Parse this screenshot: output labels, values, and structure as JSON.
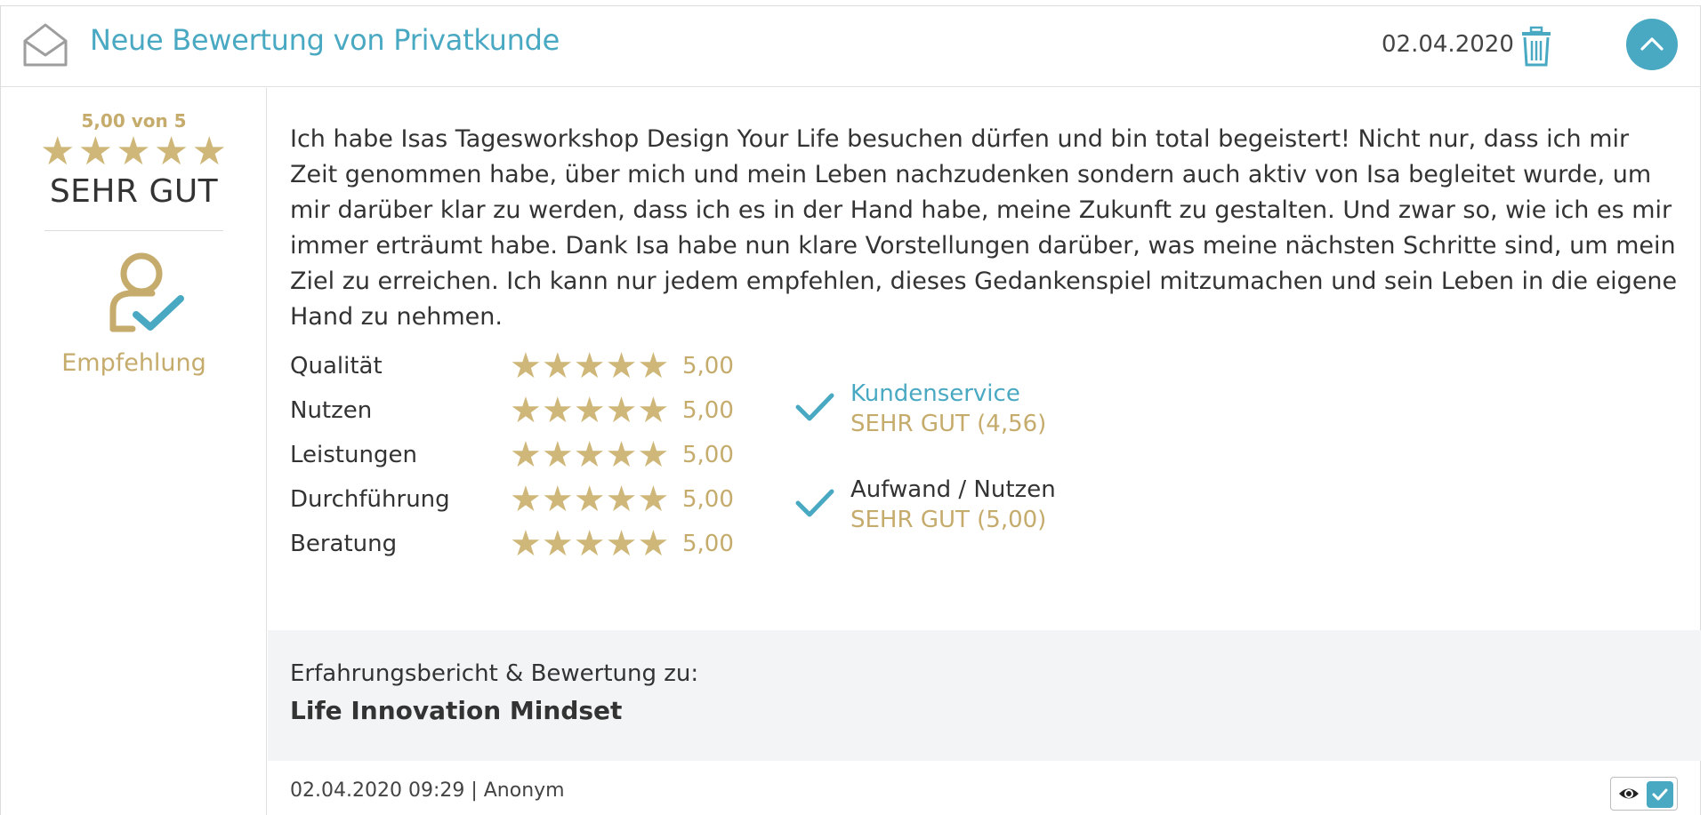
{
  "header": {
    "title": "Neue Bewertung von Privatkunde",
    "date": "02.04.2020",
    "icons": {
      "envelope": "envelope-icon",
      "trash": "trash-icon",
      "collapse": "chevron-up-icon"
    }
  },
  "summary": {
    "score_text": "5,00 von 5",
    "stars": 5,
    "grade": "SEHR GUT",
    "recommendation": "Empfehlung"
  },
  "review_text": "Ich habe Isas Tagesworkshop Design Your Life besuchen dürfen und bin total begeistert! Nicht nur, dass ich mir Zeit genommen habe, über mich und mein Leben nachzudenken sondern auch aktiv von Isa begleitet wurde, um mir darüber klar zu werden, dass ich es in der Hand habe, meine Zukunft zu gestalten. Und zwar so, wie ich es mir immer erträumt habe. Dank Isa habe nun klare Vorstellungen darüber, was meine nächsten Schritte sind, um mein Ziel zu erreichen. Ich kann nur jedem empfehlen, dieses Gedankenspiel mitzumachen und sein Leben in die eigene Hand zu nehmen.",
  "ratings": [
    {
      "label": "Qualität",
      "stars": 5,
      "value": "5,00"
    },
    {
      "label": "Nutzen",
      "stars": 5,
      "value": "5,00"
    },
    {
      "label": "Leistungen",
      "stars": 5,
      "value": "5,00"
    },
    {
      "label": "Durchführung",
      "stars": 5,
      "value": "5,00"
    },
    {
      "label": "Beratung",
      "stars": 5,
      "value": "5,00"
    }
  ],
  "checks": [
    {
      "title": "Kundenservice",
      "subtitle": "SEHR GUT (4,56)",
      "title_color": "#4aa9c2"
    },
    {
      "title": "Aufwand / Nutzen",
      "subtitle": "SEHR GUT (5,00)",
      "title_color": "#333333"
    }
  ],
  "product": {
    "label": "Erfahrungsbericht & Bewertung zu:",
    "name": "Life Innovation Mindset"
  },
  "meta": "02.04.2020 09:29 | Anonym",
  "colors": {
    "accent": "#4aa9c2",
    "gold": "#c5ab6c",
    "star": "#cfb779"
  }
}
